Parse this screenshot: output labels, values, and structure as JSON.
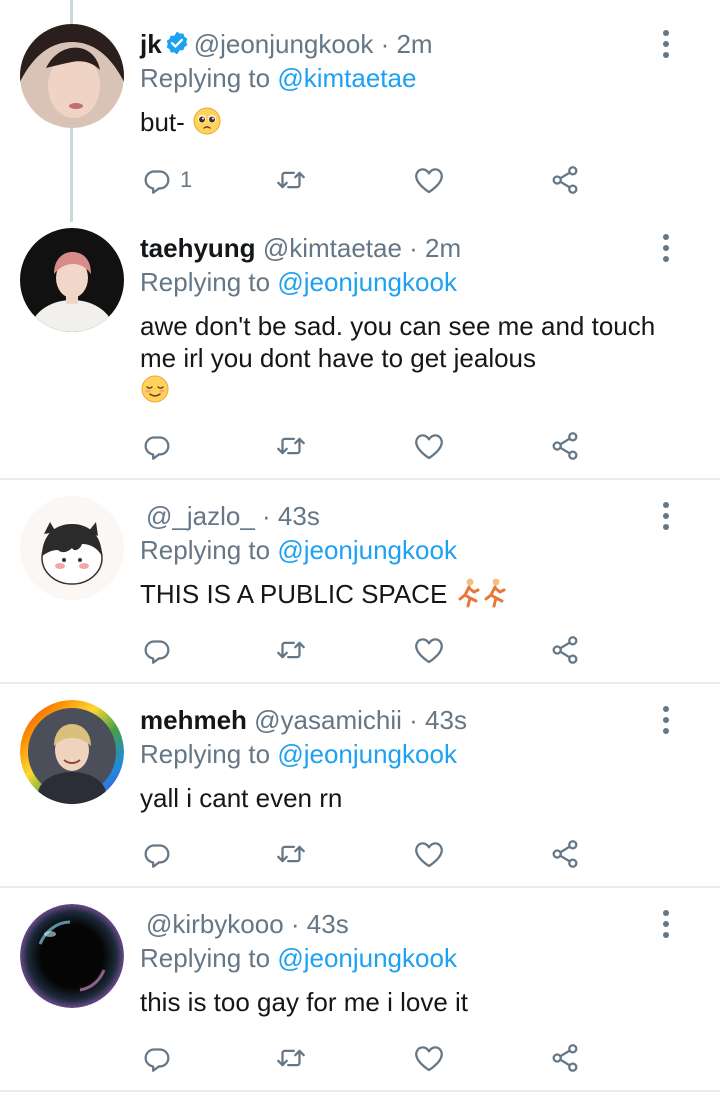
{
  "colors": {
    "link": "#1da1f2",
    "muted": "#657786",
    "text": "#14171a",
    "divider": "#e6ecf0"
  },
  "tweets": [
    {
      "name": "jk",
      "handle": "@jeonjungkook",
      "time": "· 2m",
      "verified": true,
      "replying_label": "Replying to",
      "replying_to": "@kimtaetae",
      "text": "but-",
      "emoji": "pleading-face",
      "reply_count": "1"
    },
    {
      "name": "taehyung",
      "handle": "@kimtaetae",
      "time": "· 2m",
      "replying_label": "Replying to",
      "replying_to": "@jeonjungkook",
      "text": "awe don't be sad. you can see me and touch me irl you dont have to get jealous",
      "emoji": "relieved-face",
      "reply_count": ""
    },
    {
      "name": "",
      "handle": "@_jazlo_",
      "time": "· 43s",
      "replying_label": "Replying to",
      "replying_to": "@jeonjungkook",
      "text": "THIS IS A PUBLIC SPACE",
      "emoji": "running-person x2",
      "reply_count": ""
    },
    {
      "name": "mehmeh",
      "handle": "@yasamichii",
      "time": "· 43s",
      "replying_label": "Replying to",
      "replying_to": "@jeonjungkook",
      "text": "yall i cant even rn",
      "reply_count": ""
    },
    {
      "name": "",
      "handle": "@kirbykooo",
      "time": "· 43s",
      "replying_label": "Replying to",
      "replying_to": "@jeonjungkook",
      "text": "this is too gay for me i love it",
      "reply_count": ""
    }
  ],
  "icons": {
    "reply": "reply-icon",
    "retweet": "retweet-icon",
    "like": "heart-icon",
    "share": "share-icon",
    "more": "more-options-icon"
  }
}
